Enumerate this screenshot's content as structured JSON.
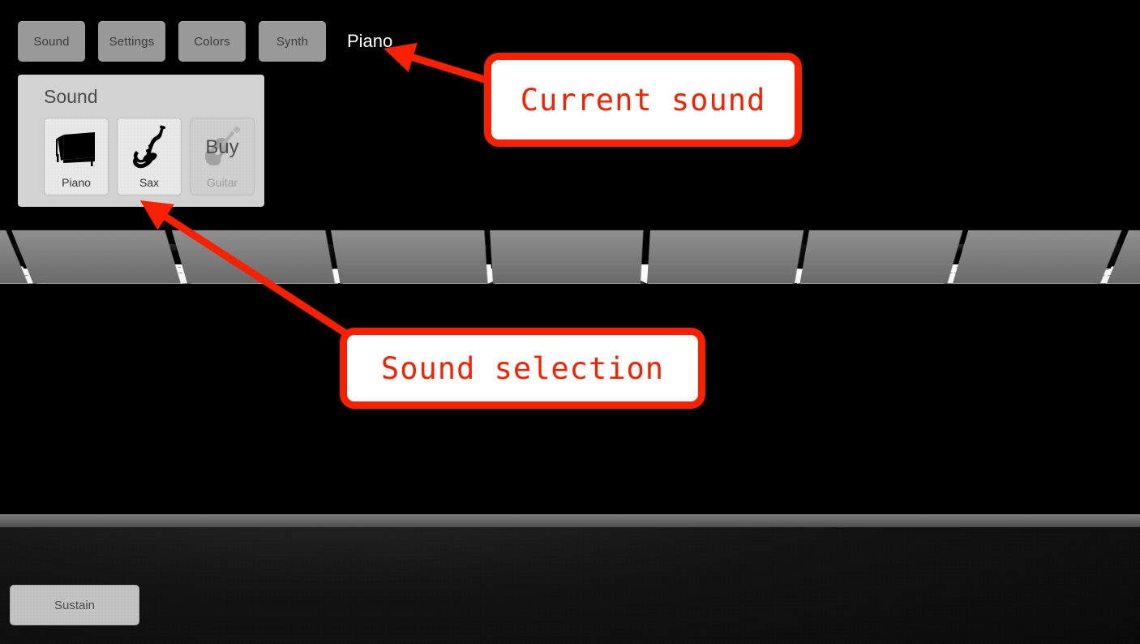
{
  "app": {
    "title": "Piano",
    "background_color": "#000000"
  },
  "toolbar": {
    "buttons": [
      {
        "label": "Sound",
        "name": "sound"
      },
      {
        "label": "Settings",
        "name": "settings"
      },
      {
        "label": "Colors",
        "name": "colors"
      },
      {
        "label": "Synth",
        "name": "synth"
      }
    ],
    "current_sound": "Piano",
    "button_color": "#999999",
    "button_text_color": "#3b3b3b",
    "current_sound_color": "#ffffff"
  },
  "sound_panel": {
    "title": "Sound",
    "panel_color": "#d2d2d2",
    "options": [
      {
        "label": "Piano",
        "icon": "grand-piano-icon",
        "locked": false,
        "selected": true,
        "overlay": ""
      },
      {
        "label": "Sax",
        "icon": "saxophone-icon",
        "locked": false,
        "selected": false,
        "overlay": ""
      },
      {
        "label": "Guitar",
        "icon": "guitar-icon",
        "locked": true,
        "selected": false,
        "overlay": "Buy"
      }
    ]
  },
  "controls": {
    "sustain_label": "Sustain"
  },
  "annotations": {
    "accent_color": "#f92000",
    "items": [
      {
        "text": "Current sound",
        "target": "current-sound-label"
      },
      {
        "text": "Sound selection",
        "target": "sound-panel"
      }
    ]
  },
  "keyboard": {
    "white_key_count": 13,
    "black_key_count": 9,
    "white_key_color": "#ffffff",
    "black_key_color": "#0c0c0c"
  }
}
